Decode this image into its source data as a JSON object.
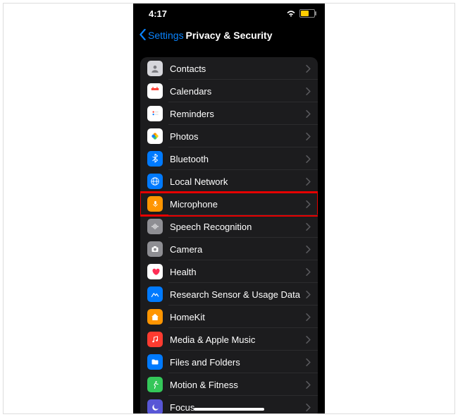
{
  "status": {
    "time": "4:17"
  },
  "nav": {
    "back": "Settings",
    "title": "Privacy & Security"
  },
  "colors": {
    "contacts": "#d6d6db",
    "calendars": "#ffffff",
    "reminders": "#ffffff",
    "photos": "#ffffff",
    "bluetooth": "#007aff",
    "localnetwork": "#007aff",
    "microphone": "#ff9500",
    "speech": "#8e8e93",
    "camera": "#8e8e93",
    "health": "#ffffff",
    "research": "#007aff",
    "homekit": "#ff9500",
    "media": "#ff3b30",
    "files": "#007aff",
    "motion": "#34c759",
    "focus": "#5856d6"
  },
  "items": [
    {
      "key": "contacts",
      "label": "Contacts",
      "icon": "contacts-icon"
    },
    {
      "key": "calendars",
      "label": "Calendars",
      "icon": "calendar-icon"
    },
    {
      "key": "reminders",
      "label": "Reminders",
      "icon": "reminders-icon"
    },
    {
      "key": "photos",
      "label": "Photos",
      "icon": "photos-icon"
    },
    {
      "key": "bluetooth",
      "label": "Bluetooth",
      "icon": "bluetooth-icon"
    },
    {
      "key": "localnetwork",
      "label": "Local Network",
      "icon": "local-network-icon"
    },
    {
      "key": "microphone",
      "label": "Microphone",
      "icon": "microphone-icon",
      "highlighted": true
    },
    {
      "key": "speech",
      "label": "Speech Recognition",
      "icon": "speech-icon"
    },
    {
      "key": "camera",
      "label": "Camera",
      "icon": "camera-icon"
    },
    {
      "key": "health",
      "label": "Health",
      "icon": "health-icon"
    },
    {
      "key": "research",
      "label": "Research Sensor & Usage Data",
      "icon": "research-icon"
    },
    {
      "key": "homekit",
      "label": "HomeKit",
      "icon": "homekit-icon"
    },
    {
      "key": "media",
      "label": "Media & Apple Music",
      "icon": "media-icon"
    },
    {
      "key": "files",
      "label": "Files and Folders",
      "icon": "files-icon"
    },
    {
      "key": "motion",
      "label": "Motion & Fitness",
      "icon": "motion-icon"
    },
    {
      "key": "focus",
      "label": "Focus",
      "icon": "focus-icon"
    }
  ]
}
